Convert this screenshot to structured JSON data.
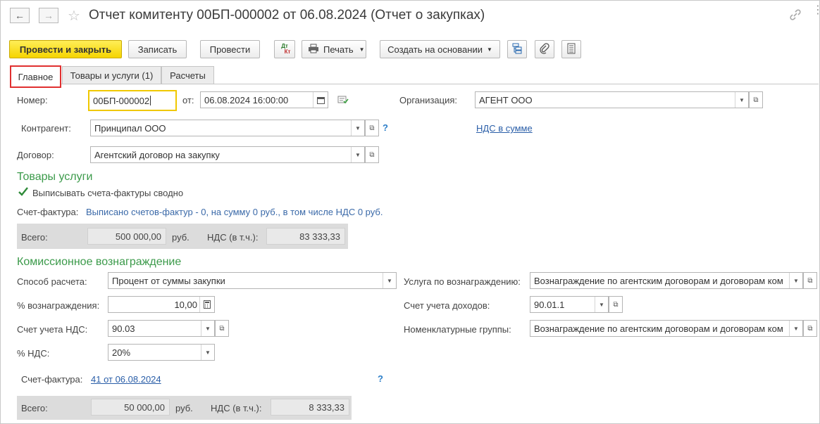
{
  "window": {
    "title": "Отчет комитенту 00БП-000002 от 06.08.2024 (Отчет о закупках)",
    "back_icon": "arrow-left-icon",
    "forward_icon": "arrow-right-icon",
    "star_icon": "star-icon",
    "link_icon": "link-icon",
    "more_icon": "more-icon"
  },
  "toolbar": {
    "post_close": "Провести и закрыть",
    "save": "Записать",
    "post": "Провести",
    "dtkt_top": "Дт",
    "dtkt_bottom": "Кт",
    "print": "Печать",
    "create_based": "Создать на основании"
  },
  "tabs": [
    {
      "label": "Главное",
      "active": true
    },
    {
      "label": "Товары и услуги (1)",
      "active": false
    },
    {
      "label": "Расчеты",
      "active": false
    }
  ],
  "header": {
    "number_label": "Номер:",
    "number_value": "00БП-000002",
    "date_label": "от:",
    "date_value": "06.08.2024 16:00:00",
    "org_label": "Организация:",
    "org_value": "АГЕНТ ООО",
    "contractor_label": "Контрагент:",
    "contractor_value": "Принципал ООО",
    "vat_link": "НДС в сумме",
    "contract_label": "Договор:",
    "contract_value": "Агентский договор на закупку",
    "help": "?"
  },
  "goods": {
    "section_title": "Товары услуги",
    "summary_checkbox": "Выписывать счета-фактуры сводно",
    "summary_checked": true,
    "invoice_label": "Счет-фактура:",
    "invoice_text": "Выписано счетов-фактур - 0, на сумму 0 руб., в том числе НДС 0 руб.",
    "total_label": "Всего:",
    "total_value": "500 000,00",
    "currency": "руб.",
    "vat_label": "НДС (в т.ч.):",
    "vat_value": "83 333,33"
  },
  "commission": {
    "section_title": "Комиссионное вознаграждение",
    "method_label": "Способ расчета:",
    "method_value": "Процент от суммы закупки",
    "service_label": "Услуга по вознаграждению:",
    "service_value": "Вознаграждение по агентским договорам и договорам ком",
    "percent_label": "% вознаграждения:",
    "percent_value": "10,00",
    "income_label": "Счет учета доходов:",
    "income_value": "90.01.1",
    "vat_account_label": "Счет учета НДС:",
    "vat_account_value": "90.03",
    "nomen_label": "Номенклатурные группы:",
    "nomen_value": "Вознаграждение по агентским договорам и договорам ком",
    "vat_rate_label": "% НДС:",
    "vat_rate_value": "20%",
    "invoice_label": "Счет-фактура:",
    "invoice_link": "41 от 06.08.2024",
    "help": "?",
    "total_label": "Всего:",
    "total_value": "50 000,00",
    "currency": "руб.",
    "vat_label": "НДС (в т.ч.):",
    "vat_value": "8 333,33"
  },
  "colors": {
    "accent_yellow": "#f5d400",
    "section_green": "#3b9a4a",
    "link_blue": "#2a5ea8",
    "highlight_red": "#e03030"
  }
}
